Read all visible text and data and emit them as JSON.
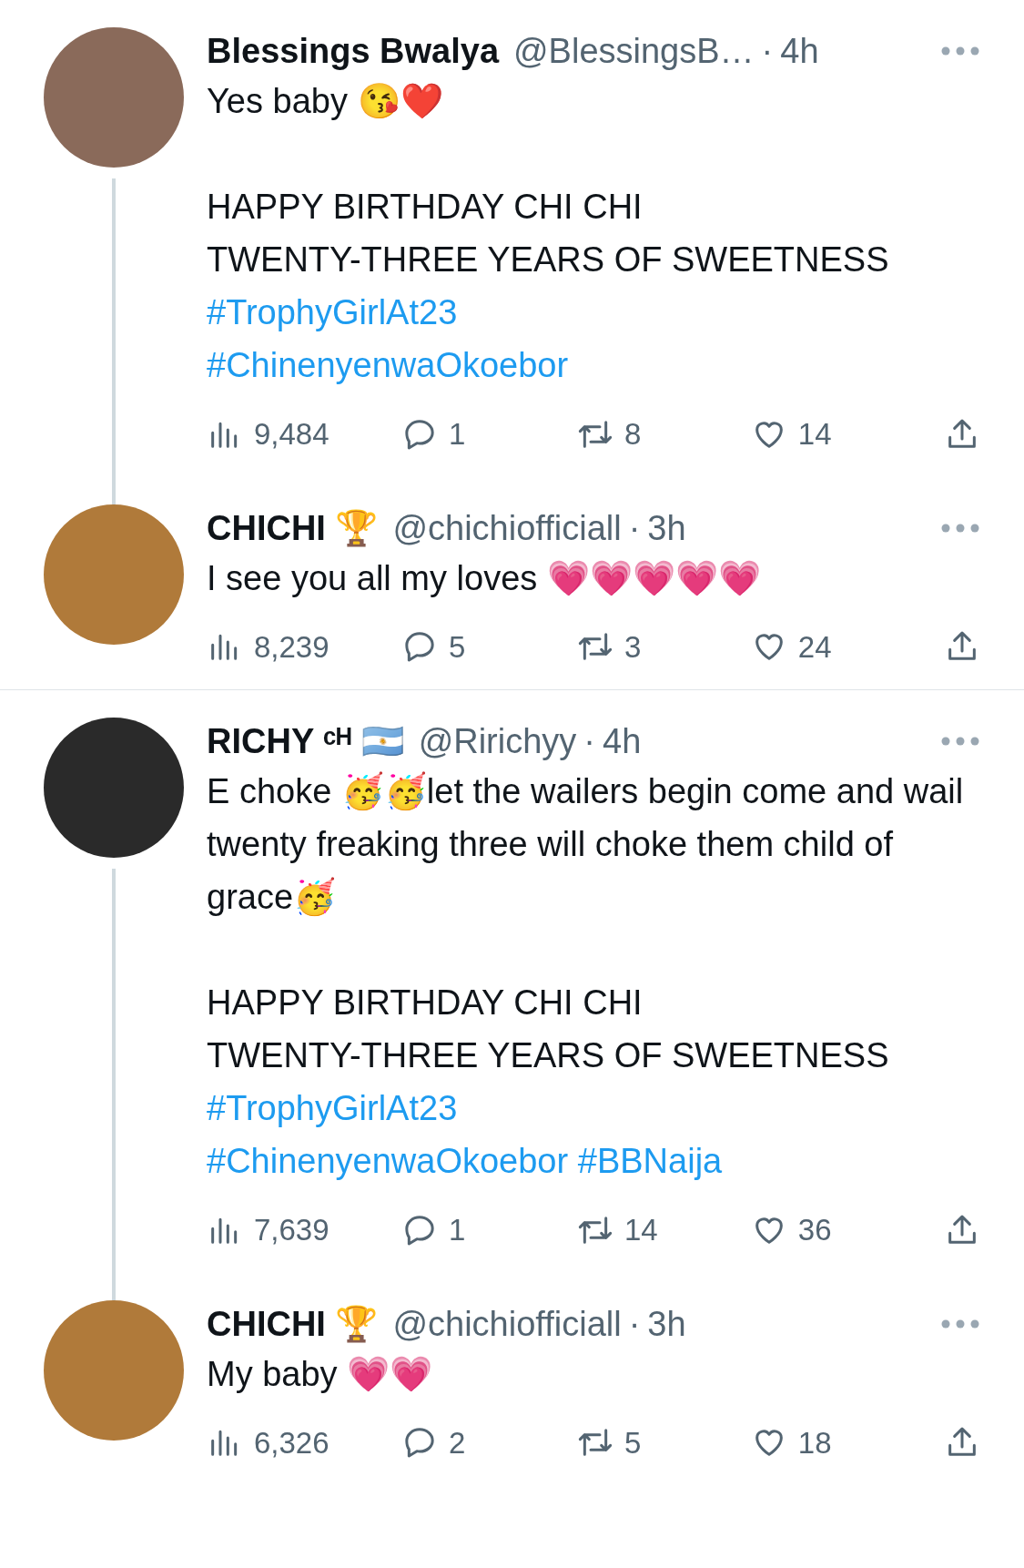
{
  "threads": [
    {
      "tweets": [
        {
          "name": "Blessings Bwalya",
          "handle": "@BlessingsB…",
          "separator": "·",
          "time": "4h",
          "connector": true,
          "paragraphs": [
            [
              [
                {
                  "kind": "text",
                  "text": "Yes baby 😘❤️"
                }
              ]
            ],
            [
              [
                {
                  "kind": "text",
                  "text": "HAPPY BIRTHDAY CHI CHI"
                }
              ],
              [
                {
                  "kind": "text",
                  "text": "TWENTY-THREE YEARS OF SWEETNESS"
                }
              ],
              [
                {
                  "kind": "hashtag",
                  "text": "#TrophyGirlAt23"
                }
              ],
              [
                {
                  "kind": "hashtag",
                  "text": "#ChinenyenwaOkoebor"
                }
              ]
            ]
          ],
          "views": "9,484",
          "replies": "1",
          "retweets": "8",
          "likes": "14"
        },
        {
          "name": "CHICHI 🏆",
          "handle": "@chichiofficiall",
          "separator": "·",
          "time": "3h",
          "connector": false,
          "paragraphs": [
            [
              [
                {
                  "kind": "text",
                  "text": "I see you all my loves 💗💗💗💗💗"
                }
              ]
            ]
          ],
          "views": "8,239",
          "replies": "5",
          "retweets": "3",
          "likes": "24"
        }
      ]
    },
    {
      "tweets": [
        {
          "name": "RICHY ᶜᴴ 🇦🇷",
          "handle": "@Ririchyy",
          "separator": "·",
          "time": "4h",
          "connector": true,
          "paragraphs": [
            [
              [
                {
                  "kind": "text",
                  "text": "E choke 🥳🥳let the wailers begin come and wail twenty freaking three will choke them child of grace🥳"
                }
              ]
            ],
            [
              [
                {
                  "kind": "text",
                  "text": "HAPPY BIRTHDAY CHI CHI"
                }
              ],
              [
                {
                  "kind": "text",
                  "text": "TWENTY-THREE YEARS OF SWEETNESS"
                }
              ],
              [
                {
                  "kind": "hashtag",
                  "text": "#TrophyGirlAt23"
                }
              ],
              [
                {
                  "kind": "hashtag",
                  "text": "#ChinenyenwaOkoebor"
                },
                {
                  "kind": "hashtag",
                  "text": "#BBNaija"
                }
              ]
            ]
          ],
          "views": "7,639",
          "replies": "1",
          "retweets": "14",
          "likes": "36"
        },
        {
          "name": "CHICHI 🏆",
          "handle": "@chichiofficiall",
          "separator": "·",
          "time": "3h",
          "connector": false,
          "paragraphs": [
            [
              [
                {
                  "kind": "text",
                  "text": "My baby 💗💗"
                }
              ]
            ]
          ],
          "views": "6,326",
          "replies": "2",
          "retweets": "5",
          "likes": "18"
        }
      ]
    }
  ]
}
